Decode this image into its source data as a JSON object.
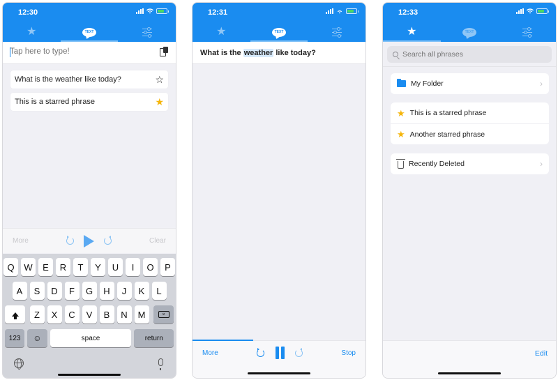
{
  "phones": [
    {
      "status": {
        "time": "12:30"
      },
      "tabs": [
        {
          "name": "favorites",
          "icon": "star-icon",
          "active": false
        },
        {
          "name": "text",
          "icon": "speech-bubble-icon",
          "label": "TEXT",
          "active": true
        },
        {
          "name": "settings",
          "icon": "sliders-icon",
          "active": false
        }
      ],
      "input": {
        "placeholder": "Tap here to type!",
        "value": ""
      },
      "phrases": [
        {
          "text": "What is the weather like today?",
          "starred": false
        },
        {
          "text": "This is a starred phrase",
          "starred": true
        }
      ],
      "controls": {
        "more": "More",
        "clear": "Clear"
      },
      "keyboard": {
        "row1": [
          "Q",
          "W",
          "E",
          "R",
          "T",
          "Y",
          "U",
          "I",
          "O",
          "P"
        ],
        "row2": [
          "A",
          "S",
          "D",
          "F",
          "G",
          "H",
          "J",
          "K",
          "L"
        ],
        "row3": [
          "Z",
          "X",
          "C",
          "V",
          "B",
          "N",
          "M"
        ],
        "numbers": "123",
        "space": "space",
        "return": "return"
      }
    },
    {
      "status": {
        "time": "12:31"
      },
      "tabs": [
        {
          "name": "favorites",
          "icon": "star-icon",
          "active": false
        },
        {
          "name": "text",
          "icon": "speech-bubble-icon",
          "label": "TEXT",
          "active": true
        },
        {
          "name": "settings",
          "icon": "sliders-icon",
          "active": false
        }
      ],
      "speaking": {
        "before": "What is the ",
        "highlight": "weather",
        "after": " like today?"
      },
      "progress": 0.35,
      "controls": {
        "more": "More",
        "stop": "Stop"
      }
    },
    {
      "status": {
        "time": "12:33"
      },
      "tabs": [
        {
          "name": "favorites",
          "icon": "star-icon",
          "active": true
        },
        {
          "name": "text",
          "icon": "speech-bubble-icon",
          "label": "TEXT",
          "active": false
        },
        {
          "name": "settings",
          "icon": "sliders-icon",
          "active": false
        }
      ],
      "search": {
        "placeholder": "Search all phrases"
      },
      "folders": [
        {
          "name": "My Folder"
        }
      ],
      "starred": [
        {
          "text": "This is a starred phrase"
        },
        {
          "text": "Another starred phrase"
        }
      ],
      "recently_deleted": "Recently Deleted",
      "edit": "Edit"
    }
  ],
  "colors": {
    "accent": "#1a8cf0",
    "star": "#f5b50a",
    "background": "#f0f0f5"
  }
}
